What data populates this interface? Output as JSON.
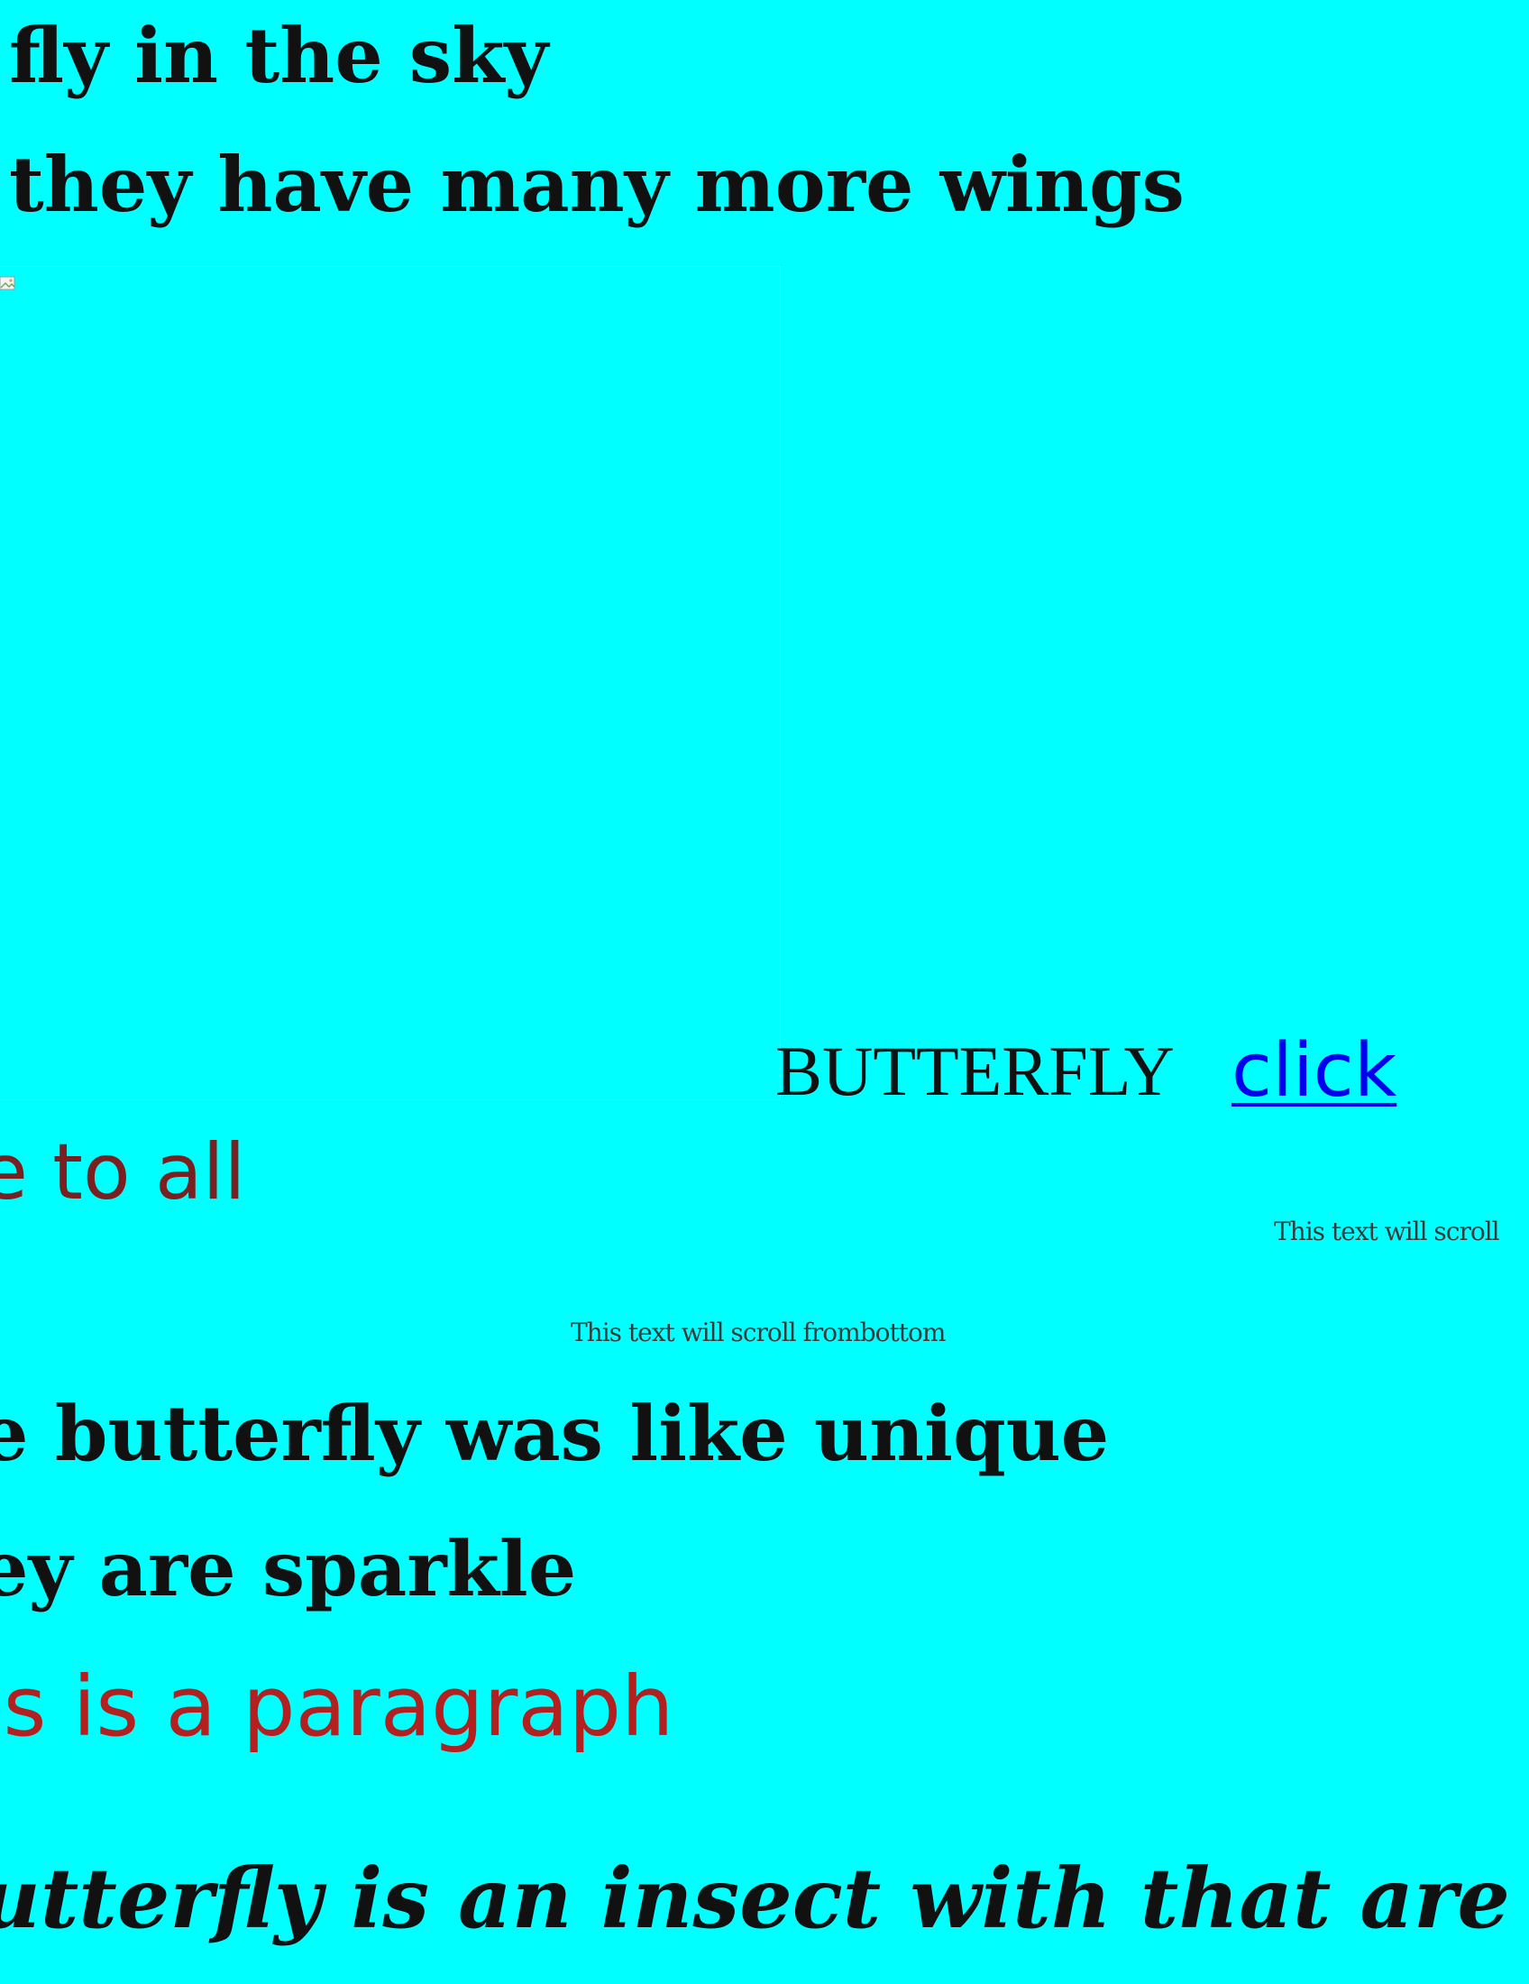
{
  "colors": {
    "background": "#00ffff",
    "link": "#0000ee",
    "welcome": "#7a2020",
    "paragraph": "#b32020",
    "marquee": "#3b3b3b"
  },
  "headings": {
    "line1": "fly in the sky",
    "line2": "they have many more wings",
    "line3": "e butterfly was like unique",
    "line4": "ey are sparkle"
  },
  "image": {
    "icon": "broken-image-icon"
  },
  "butterfly_label": "BUTTERFLY",
  "link": {
    "label": "click"
  },
  "welcome_text": "e to all",
  "marquees": {
    "right": "This text will scroll",
    "bottom": "This text will scroll frombottom"
  },
  "paragraph": "is is a paragraph",
  "cursive_text": "utterfly is an insect with that are"
}
